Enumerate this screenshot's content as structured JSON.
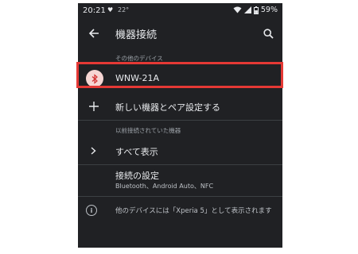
{
  "status_bar": {
    "time": "20:21",
    "temperature": "22°",
    "battery": "59%"
  },
  "app_bar": {
    "title": "機器接続"
  },
  "sections": {
    "other_devices": "その他のデバイス",
    "previously_connected": "以前接続されていた機器"
  },
  "device": {
    "name": "WNW-21A",
    "icon": "bluetooth-icon"
  },
  "actions": {
    "pair_new": "新しい機器とペア設定する",
    "show_all": "すべて表示"
  },
  "connection_settings": {
    "title": "接続の設定",
    "subtitle": "Bluetooth、Android Auto、NFC"
  },
  "info": {
    "text": "他のデバイスには「Xperia 5」として表示されます"
  },
  "colors": {
    "background": "#202124",
    "highlight": "#e53935",
    "bluetooth_badge": "#f6d6d3"
  }
}
